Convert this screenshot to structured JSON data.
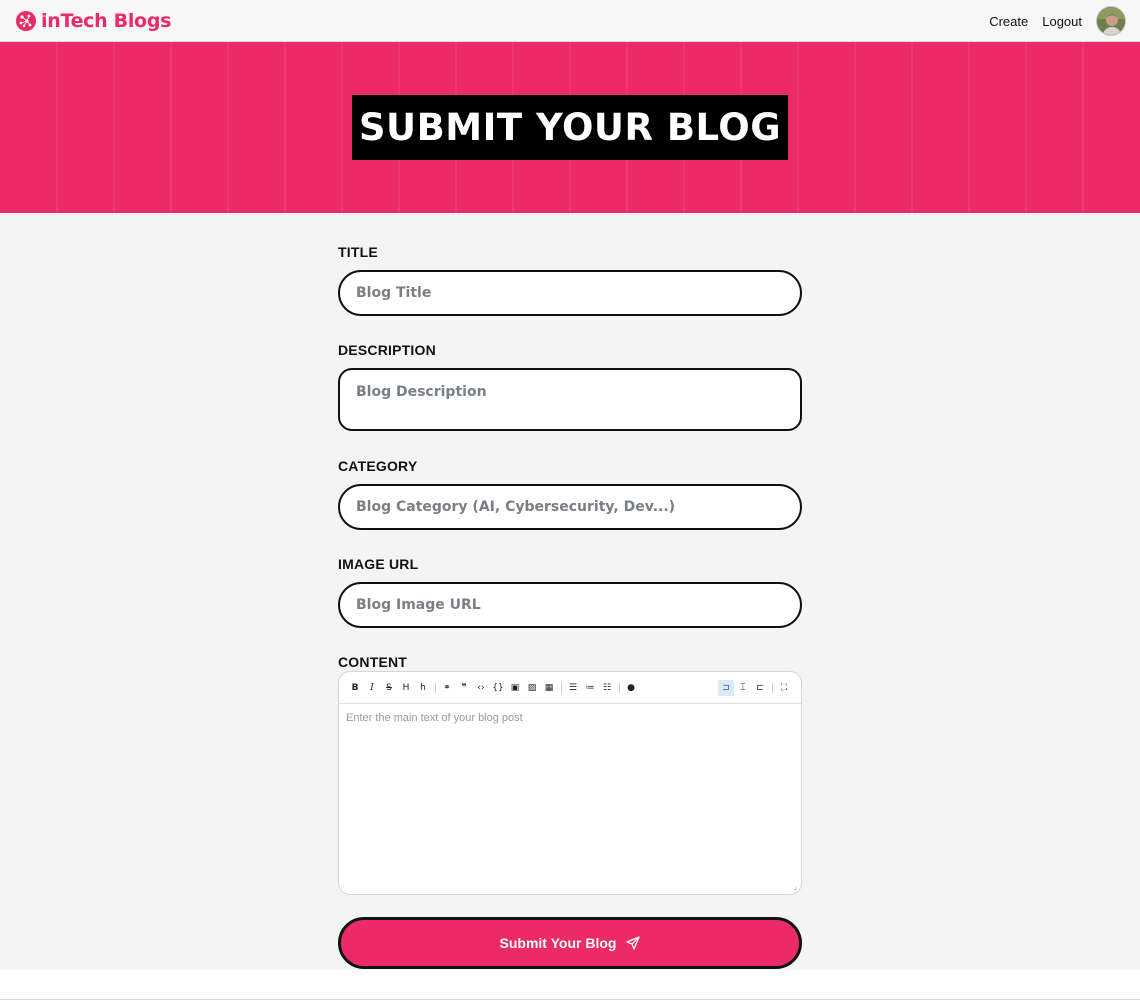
{
  "header": {
    "brand": "inTech Blogs",
    "nav": [
      "Create",
      "Logout"
    ],
    "avatar_icon": "user-avatar"
  },
  "hero": {
    "title": "SUBMIT YOUR BLOG",
    "background_color": "#ec2a67"
  },
  "form": {
    "title": {
      "label": "TITLE",
      "placeholder": "Blog Title",
      "value": ""
    },
    "description": {
      "label": "DESCRIPTION",
      "placeholder": "Blog Description",
      "value": ""
    },
    "category": {
      "label": "CATEGORY",
      "placeholder": "Blog Category (AI, Cybersecurity, Dev...)",
      "value": ""
    },
    "image_url": {
      "label": "IMAGE URL",
      "placeholder": "Blog Image URL",
      "value": ""
    },
    "content": {
      "label": "CONTENT",
      "placeholder": "Enter the main text of your blog post",
      "toolbar_left": [
        "bold-icon",
        "italic-icon",
        "strikethrough-icon",
        "heading-icon",
        "heading-small-icon",
        "link-icon",
        "quote-icon",
        "code-icon",
        "code-block-icon",
        "comment-icon",
        "image-icon",
        "table-icon",
        "bullet-list-icon",
        "ordered-list-icon",
        "checklist-icon",
        "help-icon"
      ],
      "toolbar_right": [
        "edit-mode-icon",
        "live-mode-icon",
        "preview-mode-icon",
        "fullscreen-icon"
      ]
    },
    "submit_label": "Submit Your Blog",
    "submit_icon": "send-icon"
  },
  "colors": {
    "accent": "#ec2a67",
    "text": "#111111",
    "page_bg": "#f4f4f4"
  }
}
